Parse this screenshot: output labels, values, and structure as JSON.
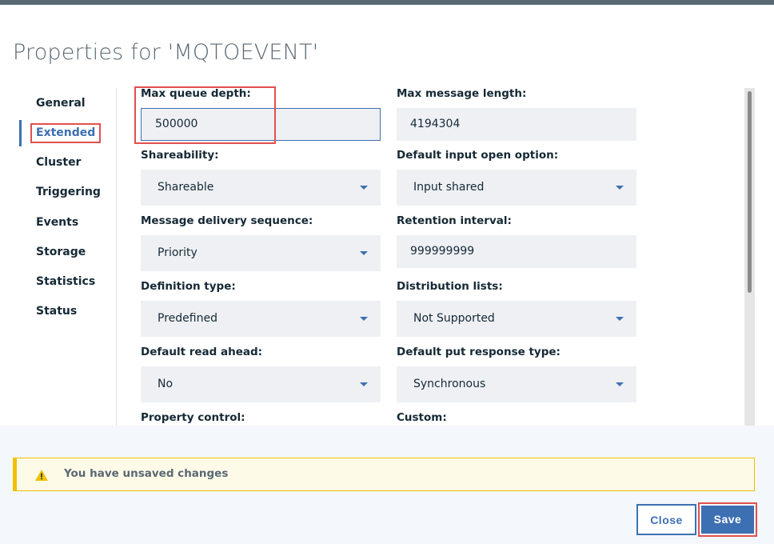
{
  "title": "Properties for 'MQTOEVENT'",
  "nav": {
    "items": [
      {
        "label": "General"
      },
      {
        "label": "Extended"
      },
      {
        "label": "Cluster"
      },
      {
        "label": "Triggering"
      },
      {
        "label": "Events"
      },
      {
        "label": "Storage"
      },
      {
        "label": "Statistics"
      },
      {
        "label": "Status"
      }
    ],
    "active": "Extended"
  },
  "fields": {
    "max_queue_depth": {
      "label": "Max queue depth:",
      "value": "500000"
    },
    "max_message_length": {
      "label": "Max message length:",
      "value": "4194304"
    },
    "shareability": {
      "label": "Shareability:",
      "value": "Shareable"
    },
    "default_input_open_option": {
      "label": "Default input open option:",
      "value": "Input shared"
    },
    "message_delivery_sequence": {
      "label": "Message delivery sequence:",
      "value": "Priority"
    },
    "retention_interval": {
      "label": "Retention interval:",
      "value": "999999999"
    },
    "definition_type": {
      "label": "Definition type:",
      "value": "Predefined"
    },
    "distribution_lists": {
      "label": "Distribution lists:",
      "value": "Not Supported"
    },
    "default_read_ahead": {
      "label": "Default read ahead:",
      "value": "No"
    },
    "default_put_response_type": {
      "label": "Default put response type:",
      "value": "Synchronous"
    },
    "property_control": {
      "label": "Property control:"
    },
    "custom": {
      "label": "Custom:"
    }
  },
  "notice": {
    "text": "You have unsaved changes",
    "icon": "warning-icon"
  },
  "buttons": {
    "close": "Close",
    "save": "Save"
  },
  "colors": {
    "accent": "#3d70b2",
    "warning": "#efc100",
    "highlight": "#e0514f"
  }
}
